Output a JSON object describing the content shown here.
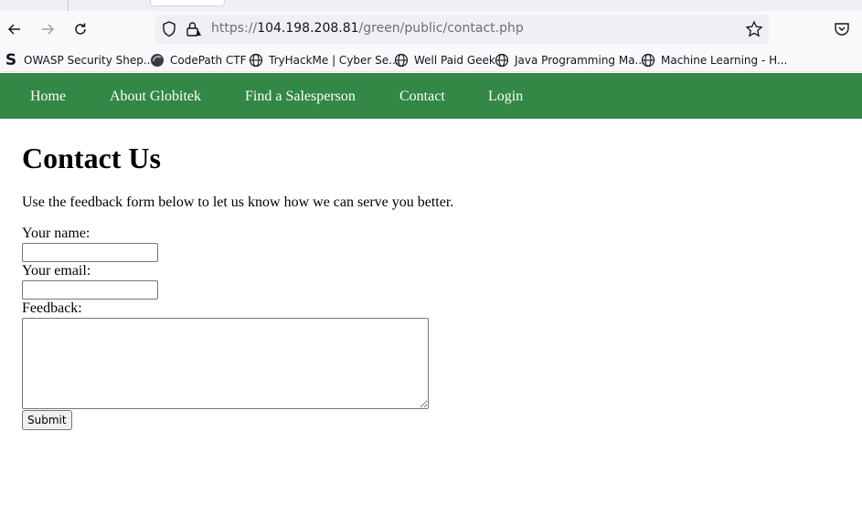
{
  "browser": {
    "url_prefix": "https://",
    "url_host": "104.198.208.81",
    "url_path": "/green/public/contact.php",
    "bookmarks": [
      {
        "label": "OWASP Security Shep...",
        "icon": "owasp-s-icon"
      },
      {
        "label": "CodePath CTF",
        "icon": "codepath-icon"
      },
      {
        "label": "TryHackMe | Cyber Se...",
        "icon": "globe-icon"
      },
      {
        "label": "Well Paid Geek",
        "icon": "globe-icon"
      },
      {
        "label": "Java Programming Ma...",
        "icon": "globe-icon"
      },
      {
        "label": "Machine Learning - H...",
        "icon": "globe-icon"
      }
    ]
  },
  "site": {
    "nav_color": "#328844",
    "nav": [
      "Home",
      "About Globitek",
      "Find a Salesperson",
      "Contact",
      "Login"
    ],
    "heading": "Contact Us",
    "intro": "Use the feedback form below to let us know how we can serve you better.",
    "form": {
      "name_label": "Your name:",
      "email_label": "Your email:",
      "feedback_label": "Feedback:",
      "name_value": "",
      "email_value": "",
      "feedback_value": "",
      "submit_label": "Submit"
    }
  }
}
